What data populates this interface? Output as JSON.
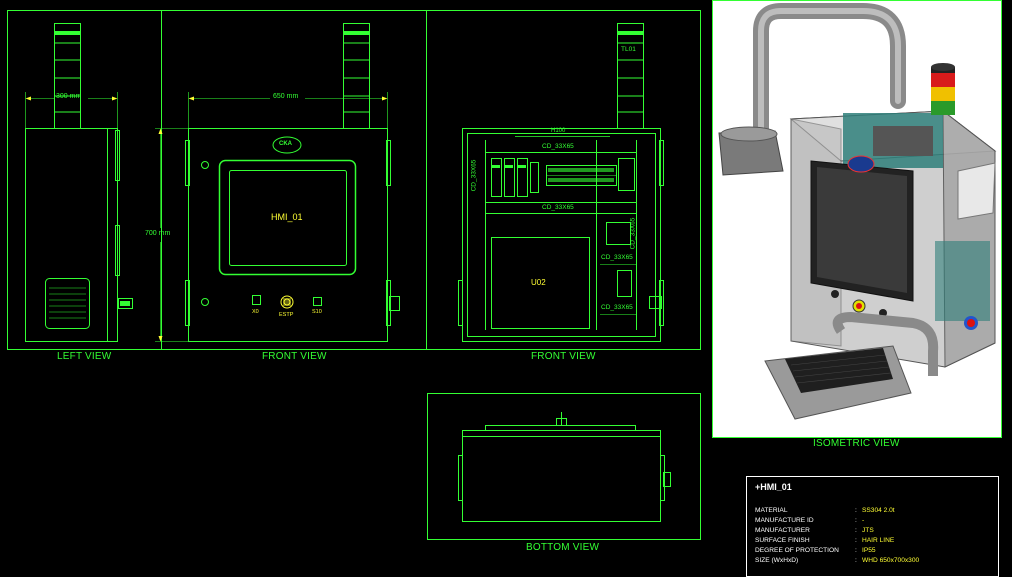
{
  "views": {
    "left": "LEFT VIEW",
    "front": "FRONT VIEW",
    "front_inner": "FRONT VIEW",
    "bottom": "BOTTOM VIEW",
    "isometric": "ISOMETRIC VIEW"
  },
  "dimensions": {
    "depth": "300 mm",
    "width": "650 mm",
    "height": "700 mm"
  },
  "front_labels": {
    "hmi": "HMI_01",
    "logo": "CKA",
    "button_1": "X0",
    "button_2": "ESTP",
    "button_3": "S10"
  },
  "inner_labels": {
    "tower": "TL01",
    "rail_top": "H100",
    "duct_top": "CD_33X65",
    "duct_mid": "CD_33X65",
    "duct_left": "CD_33X65",
    "duct_right": "CD_33X65",
    "duct_r1": "CD_33X65",
    "duct_r2": "CD_33X65",
    "unit": "U02"
  },
  "spec": {
    "title": "+HMI_01",
    "rows": [
      {
        "label": "MATERIAL",
        "value": "SS304 2.0t"
      },
      {
        "label": "MANUFACTURE ID",
        "value": "-"
      },
      {
        "label": "MANUFACTURER",
        "value": "JTS"
      },
      {
        "label": "SURFACE FINISH",
        "value": "HAIR LINE"
      },
      {
        "label": "DEGREE OF PROTECTION",
        "value": "IP55"
      },
      {
        "label": "SIZE (WxHxD)",
        "value": "WHD 650x700x300"
      }
    ]
  },
  "colors": {
    "line": "#33ff33",
    "accent": "#ffff33",
    "background": "#000000"
  }
}
